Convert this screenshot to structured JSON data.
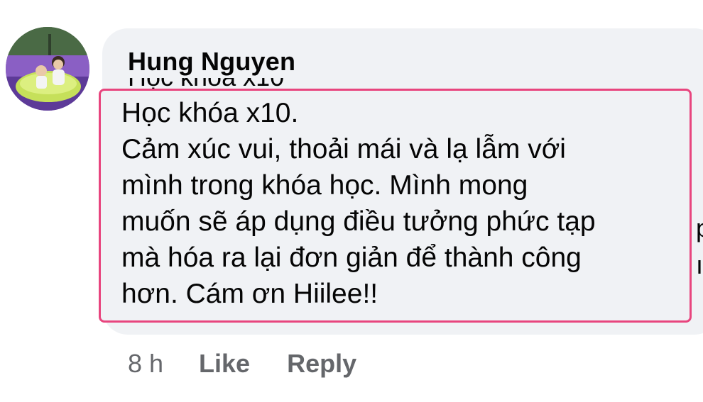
{
  "comment": {
    "author": "Hung Nguyen",
    "obscured_line": "Học khóa x10",
    "text_lines": [
      "Học khóa x10.",
      "Cảm xúc vui, thoải mái và lạ lẫm với",
      "mình trong khóa học. Mình mong",
      "muốn sẽ áp dụng điều tưởng phức tạp",
      "mà hóa ra lại đơn giản để thành công",
      "hơn. Cám ơn Hiilee!!"
    ],
    "overflow_glyphs": [
      "p",
      "ı"
    ]
  },
  "actions": {
    "time": "8 h",
    "like": "Like",
    "reply": "Reply"
  },
  "colors": {
    "bubble": "#f0f2f5",
    "highlight_border": "#e8457e",
    "meta_text": "#65676b",
    "text": "#050505"
  }
}
